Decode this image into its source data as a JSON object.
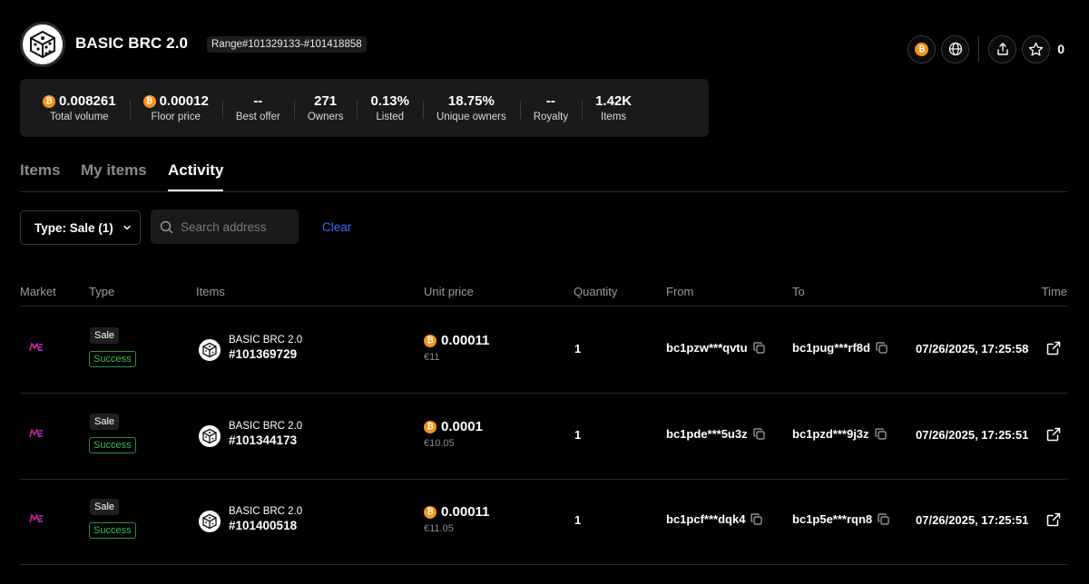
{
  "collection": {
    "title": "BASIC BRC 2.0",
    "range": "Range#101329133-#101418858",
    "star_count": "0"
  },
  "stats": [
    {
      "value": "0.008261",
      "label": "Total volume",
      "btc": true
    },
    {
      "value": "0.00012",
      "label": "Floor price",
      "btc": true
    },
    {
      "value": "--",
      "label": "Best offer",
      "btc": false
    },
    {
      "value": "271",
      "label": "Owners",
      "btc": false
    },
    {
      "value": "0.13%",
      "label": "Listed",
      "btc": false
    },
    {
      "value": "18.75%",
      "label": "Unique owners",
      "btc": false
    },
    {
      "value": "--",
      "label": "Royalty",
      "btc": false
    },
    {
      "value": "1.42K",
      "label": "Items",
      "btc": false
    }
  ],
  "tabs": [
    {
      "label": "Items",
      "active": false
    },
    {
      "label": "My items",
      "active": false
    },
    {
      "label": "Activity",
      "active": true
    }
  ],
  "filters": {
    "type_label": "Type: Sale (1)",
    "search_placeholder": "Search address",
    "clear_label": "Clear"
  },
  "table": {
    "columns": [
      "Market",
      "Type",
      "Items",
      "Unit price",
      "Quantity",
      "From",
      "To",
      "Time"
    ],
    "rows": [
      {
        "market_icon": "magic-eden-icon",
        "type": "Sale",
        "status": "Success",
        "collection": "BASIC BRC 2.0",
        "item_id": "#101369729",
        "price": "0.00011",
        "price_fiat": "€11",
        "quantity": "1",
        "from": "bc1pzw***qvtu",
        "to": "bc1pug***rf8d",
        "time": "07/26/2025, 17:25:58"
      },
      {
        "market_icon": "magic-eden-icon",
        "type": "Sale",
        "status": "Success",
        "collection": "BASIC BRC 2.0",
        "item_id": "#101344173",
        "price": "0.0001",
        "price_fiat": "€10.05",
        "quantity": "1",
        "from": "bc1pde***5u3z",
        "to": "bc1pzd***9j3z",
        "time": "07/26/2025, 17:25:51"
      },
      {
        "market_icon": "magic-eden-icon",
        "type": "Sale",
        "status": "Success",
        "collection": "BASIC BRC 2.0",
        "item_id": "#101400518",
        "price": "0.00011",
        "price_fiat": "€11.05",
        "quantity": "1",
        "from": "bc1pcf***dqk4",
        "to": "bc1p5e***rqn8",
        "time": "07/26/2025, 17:25:51"
      }
    ]
  },
  "icons": {
    "btc_symbol": "₿",
    "header_actions": [
      "bitcoin-icon",
      "globe-icon",
      "share-icon",
      "star-icon"
    ],
    "copy": "copy-icon",
    "external": "external-link-icon"
  },
  "colors": {
    "background": "#000000",
    "panel": "#1a1a1a",
    "bitcoin": "#f7931a",
    "link": "#3b6bff",
    "success": "#3cc153",
    "magic_eden": "#e42575"
  }
}
